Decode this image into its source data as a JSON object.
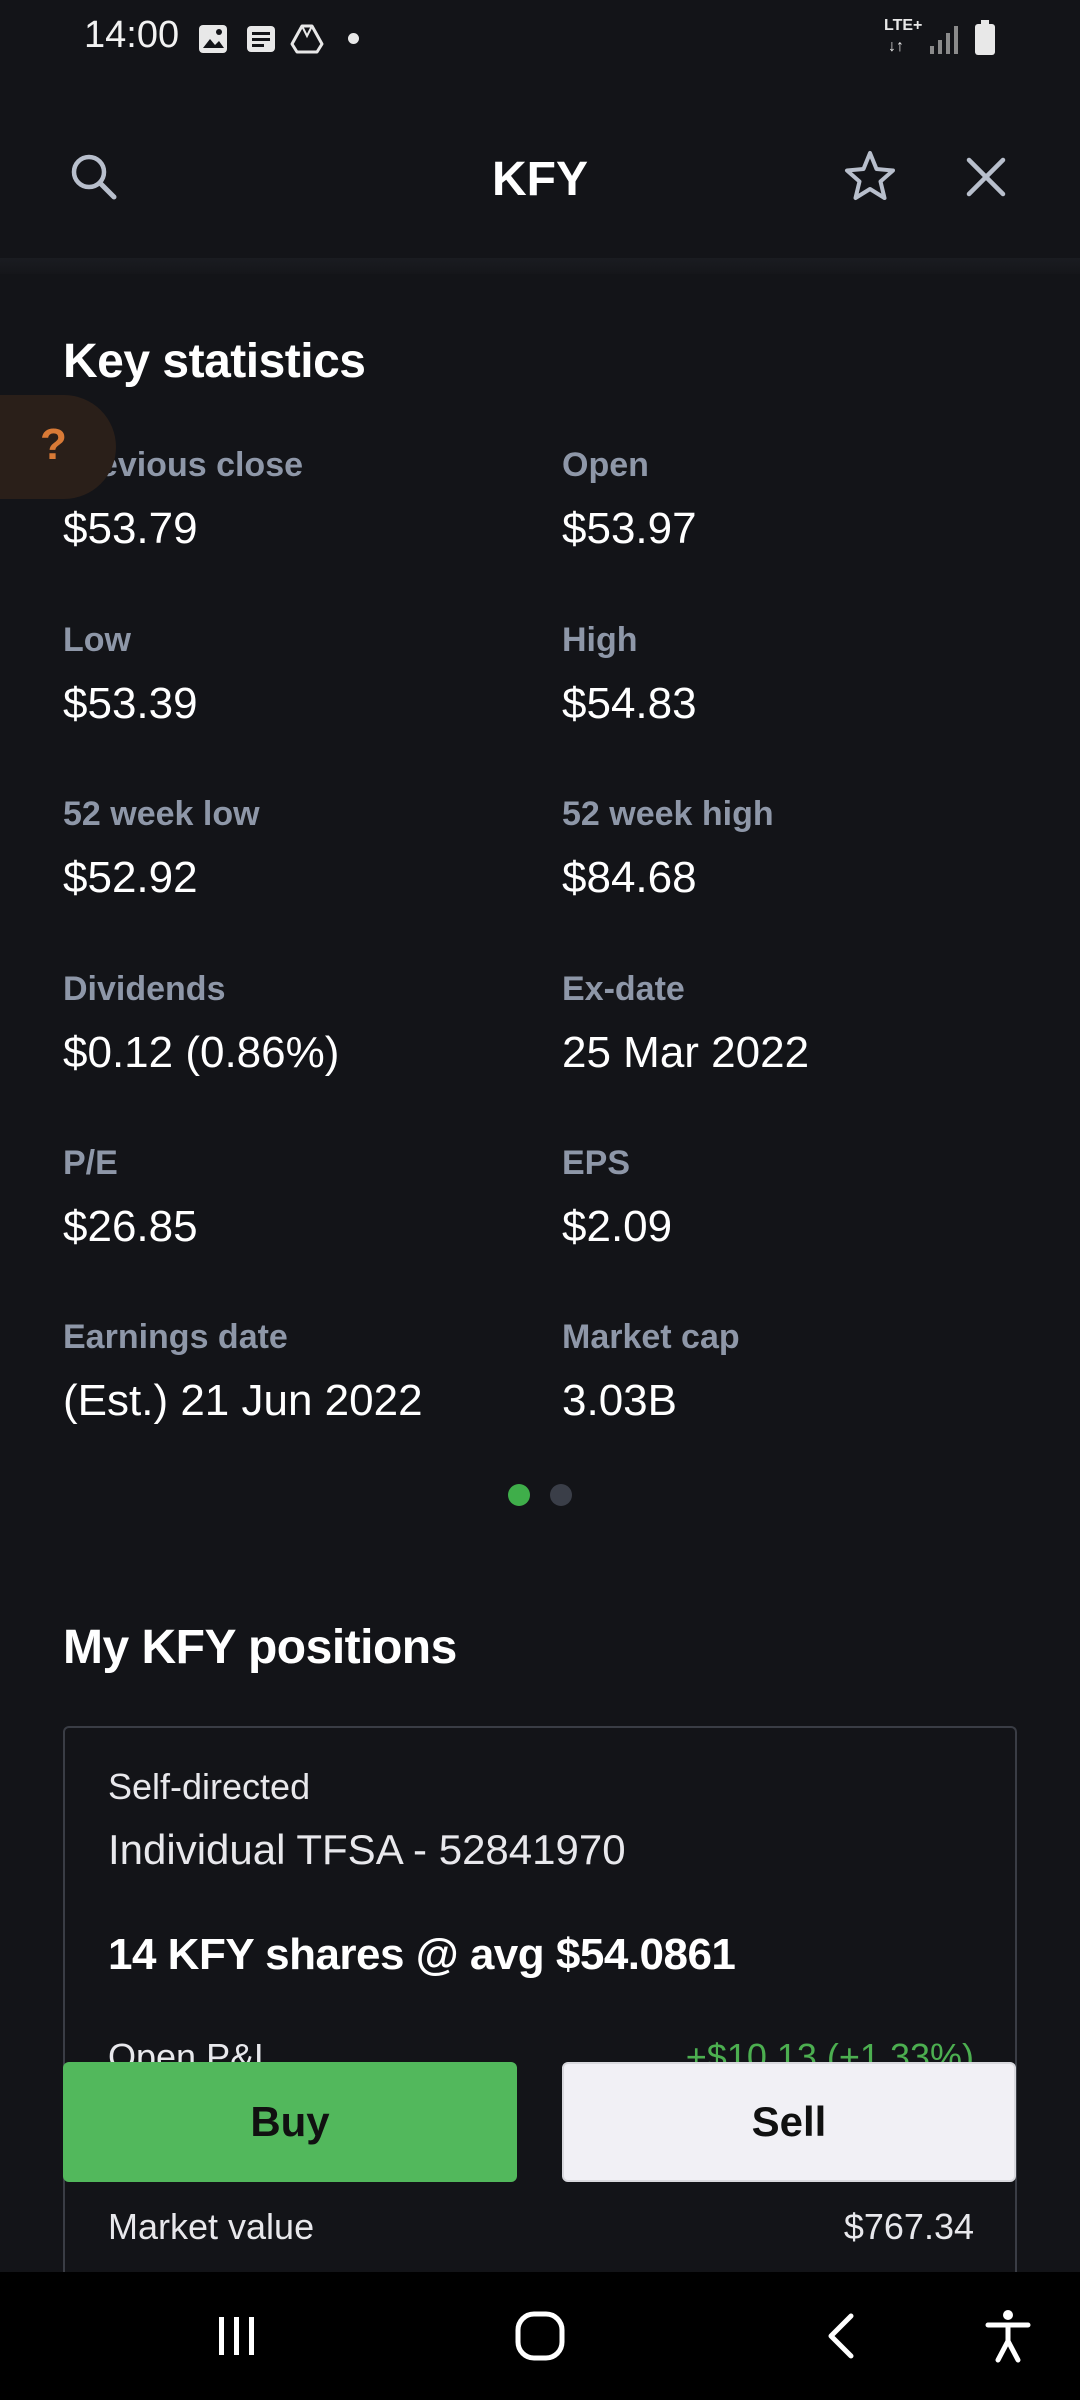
{
  "status_bar": {
    "time": "14:00",
    "network": "LTE+",
    "network_arrows": "↓↑",
    "icons": [
      "image-icon",
      "message-icon",
      "drive-icon",
      "dot-icon",
      "signal-icon",
      "battery-icon"
    ]
  },
  "header": {
    "title": "KFY",
    "icons": [
      "search-icon",
      "star-icon",
      "close-icon"
    ]
  },
  "help": {
    "glyph": "?"
  },
  "key_statistics": {
    "title": "Key statistics",
    "items": [
      {
        "label": "Previous close",
        "value": "$53.79"
      },
      {
        "label": "Open",
        "value": "$53.97"
      },
      {
        "label": "Low",
        "value": "$53.39"
      },
      {
        "label": "High",
        "value": "$54.83"
      },
      {
        "label": "52 week low",
        "value": "$52.92"
      },
      {
        "label": "52 week high",
        "value": "$84.68"
      },
      {
        "label": "Dividends",
        "value": "$0.12 (0.86%)"
      },
      {
        "label": "Ex-date",
        "value": "25 Mar 2022"
      },
      {
        "label": "P/E",
        "value": "$26.85"
      },
      {
        "label": "EPS",
        "value": "$2.09"
      },
      {
        "label": "Earnings date",
        "value": "(Est.) 21 Jun 2022"
      },
      {
        "label": "Market cap",
        "value": "3.03B"
      }
    ],
    "pager": {
      "pages": 2,
      "active": 1
    }
  },
  "positions": {
    "title": "My KFY positions",
    "account_type": "Self-directed",
    "account_name": "Individual TFSA - 52841970",
    "shares_summary": "14 KFY shares @ avg $54.0861",
    "open_pnl_label": "Open P&L",
    "open_pnl_value": "+$10.13 (+1.33%)",
    "market_value_label": "Market value",
    "market_value": "$767.34"
  },
  "actions": {
    "buy_label": "Buy",
    "sell_label": "Sell"
  },
  "nav_bar": {
    "icons": [
      "recent-apps-icon",
      "home-icon",
      "back-icon",
      "accessibility-icon"
    ]
  },
  "colors": {
    "background": "#131418",
    "label_gray": "#8e97a8",
    "buy_green": "#52b85c",
    "positive_green": "#4caf50",
    "pager_active": "#3fae4a",
    "pager_inactive": "#3a3e48",
    "help_accent": "#d97a36"
  }
}
